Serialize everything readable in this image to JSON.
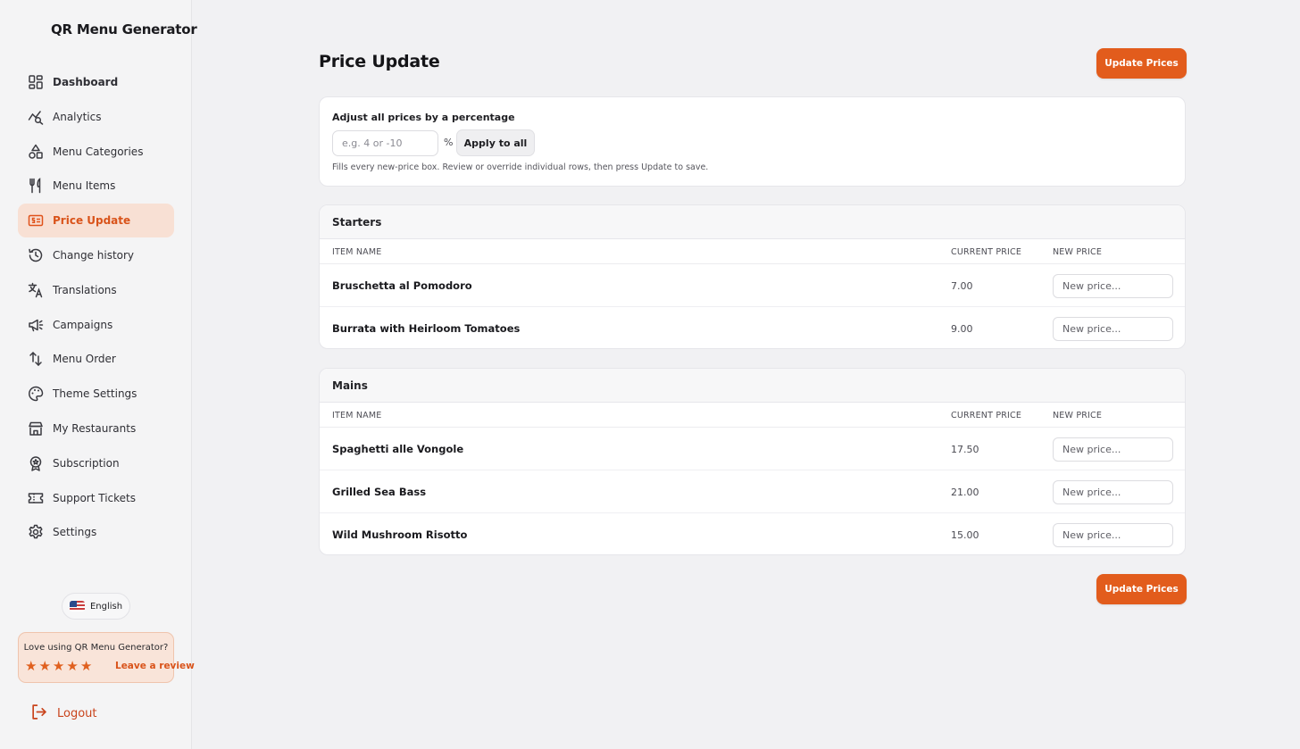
{
  "app": {
    "title": "QR Menu Generator"
  },
  "sidebar": {
    "items": [
      {
        "label": "Dashboard",
        "icon": "dashboard-icon"
      },
      {
        "label": "Analytics",
        "icon": "analytics-icon"
      },
      {
        "label": "Menu Categories",
        "icon": "categories-icon"
      },
      {
        "label": "Menu Items",
        "icon": "utensils-icon"
      },
      {
        "label": "Price Update",
        "icon": "price-tag-icon"
      },
      {
        "label": "Change history",
        "icon": "history-icon"
      },
      {
        "label": "Translations",
        "icon": "translate-icon"
      },
      {
        "label": "Campaigns",
        "icon": "megaphone-icon"
      },
      {
        "label": "Menu Order",
        "icon": "sort-arrows-icon"
      },
      {
        "label": "Theme Settings",
        "icon": "palette-icon"
      },
      {
        "label": "My Restaurants",
        "icon": "store-icon"
      },
      {
        "label": "Subscription",
        "icon": "badge-icon"
      },
      {
        "label": "Support Tickets",
        "icon": "ticket-icon"
      },
      {
        "label": "Settings",
        "icon": "gear-icon"
      }
    ],
    "active": "Price Update",
    "language": "English",
    "review": {
      "text": "Love using QR Menu Generator?",
      "link": "Leave a review",
      "stars": 5
    },
    "logout": "Logout"
  },
  "main": {
    "title": "Price Update",
    "update_button": "Update Prices",
    "adjust": {
      "label": "Adjust all prices by a percentage",
      "placeholder": "e.g. 4 or -10",
      "unit": "%",
      "apply_label": "Apply to all",
      "help": "Fills every new-price box. Review or override individual rows, then press Update to save."
    },
    "columns": {
      "name": "ITEM NAME",
      "current": "CURRENT PRICE",
      "new": "NEW PRICE"
    },
    "new_price_placeholder": "New price...",
    "categories": [
      {
        "name": "Starters",
        "items": [
          {
            "name": "Bruschetta al Pomodoro",
            "price": "7.00"
          },
          {
            "name": "Burrata with Heirloom Tomatoes",
            "price": "9.00"
          }
        ]
      },
      {
        "name": "Mains",
        "items": [
          {
            "name": "Spaghetti alle Vongole",
            "price": "17.50"
          },
          {
            "name": "Grilled Sea Bass",
            "price": "21.00"
          },
          {
            "name": "Wild Mushroom Risotto",
            "price": "15.00"
          }
        ]
      }
    ]
  },
  "colors": {
    "accent": "#e25c1c",
    "active_bg": "#f8e0d4",
    "background": "#f1f1f3"
  }
}
